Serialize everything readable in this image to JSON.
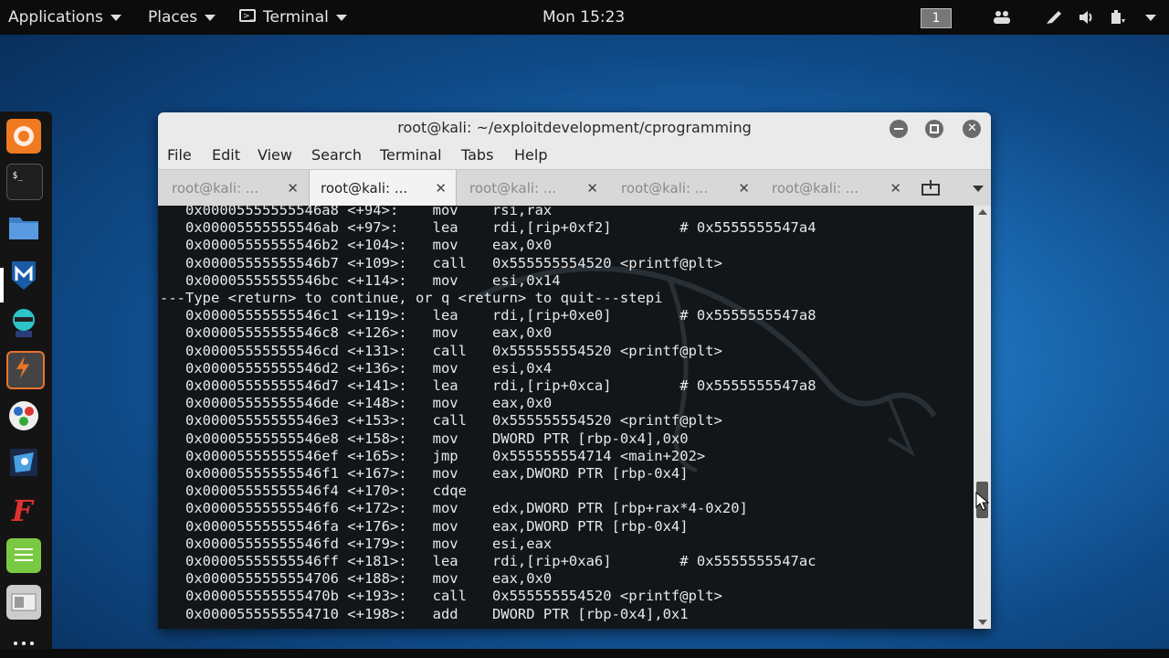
{
  "topbar": {
    "applications": "Applications",
    "places": "Places",
    "terminal": "Terminal",
    "clock": "Mon 15:23",
    "workspace": "1"
  },
  "dock": {
    "apps": [
      "firefox-icon",
      "terminal-icon",
      "files-icon",
      "metasploit-icon",
      "armitage-icon",
      "burpsuite-icon",
      "maltego-icon",
      "beef-icon",
      "faraday-icon",
      "leafpad-icon",
      "cutycapt-icon",
      "show-apps-icon"
    ]
  },
  "window": {
    "title": "root@kali: ~/exploitdevelopment/cprogramming",
    "menu": [
      "File",
      "Edit",
      "View",
      "Search",
      "Terminal",
      "Tabs",
      "Help"
    ],
    "tabs": [
      {
        "label": "root@kali: ...",
        "active": false
      },
      {
        "label": "root@kali: ...",
        "active": true
      },
      {
        "label": "root@kali: ...",
        "active": false
      },
      {
        "label": "root@kali: ...",
        "active": false
      },
      {
        "label": "root@kali: ...",
        "active": false
      }
    ],
    "close_glyph": "✕"
  },
  "terminal": {
    "lines": [
      "   0x00005555555546a8 <+94>:    mov    rsi,rax",
      "   0x00005555555546ab <+97>:    lea    rdi,[rip+0xf2]        # 0x5555555547a4",
      "   0x00005555555546b2 <+104>:   mov    eax,0x0",
      "   0x00005555555546b7 <+109>:   call   0x555555554520 <printf@plt>",
      "   0x00005555555546bc <+114>:   mov    esi,0x14",
      "---Type <return> to continue, or q <return> to quit---stepi",
      "   0x00005555555546c1 <+119>:   lea    rdi,[rip+0xe0]        # 0x5555555547a8",
      "   0x00005555555546c8 <+126>:   mov    eax,0x0",
      "   0x00005555555546cd <+131>:   call   0x555555554520 <printf@plt>",
      "   0x00005555555546d2 <+136>:   mov    esi,0x4",
      "   0x00005555555546d7 <+141>:   lea    rdi,[rip+0xca]        # 0x5555555547a8",
      "   0x00005555555546de <+148>:   mov    eax,0x0",
      "   0x00005555555546e3 <+153>:   call   0x555555554520 <printf@plt>",
      "   0x00005555555546e8 <+158>:   mov    DWORD PTR [rbp-0x4],0x0",
      "   0x00005555555546ef <+165>:   jmp    0x555555554714 <main+202>",
      "   0x00005555555546f1 <+167>:   mov    eax,DWORD PTR [rbp-0x4]",
      "   0x00005555555546f4 <+170>:   cdqe",
      "   0x00005555555546f6 <+172>:   mov    edx,DWORD PTR [rbp+rax*4-0x20]",
      "   0x00005555555546fa <+176>:   mov    eax,DWORD PTR [rbp-0x4]",
      "   0x00005555555546fd <+179>:   mov    esi,eax",
      "   0x00005555555546ff <+181>:   lea    rdi,[rip+0xa6]        # 0x5555555547ac",
      "   0x0000555555554706 <+188>:   mov    eax,0x0",
      "   0x000055555555470b <+193>:   call   0x555555554520 <printf@plt>",
      "   0x0000555555554710 <+198>:   add    DWORD PTR [rbp-0x4],0x1"
    ]
  }
}
